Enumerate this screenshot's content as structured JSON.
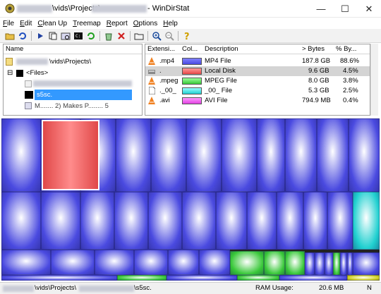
{
  "window": {
    "title_path": "\\vids\\Projects\\",
    "app_name": "- WinDirStat",
    "controls": {
      "minimize": "—",
      "maximize": "☐",
      "close": "✕"
    }
  },
  "menu": [
    {
      "label": "File",
      "key": "F",
      "rest": "ile"
    },
    {
      "label": "Edit",
      "key": "E",
      "rest": "dit"
    },
    {
      "label": "Clean Up",
      "key": "C",
      "rest": "lean Up"
    },
    {
      "label": "Treemap",
      "key": "T",
      "rest": "reemap"
    },
    {
      "label": "Report",
      "key": "R",
      "rest": "eport"
    },
    {
      "label": "Options",
      "key": "O",
      "rest": "ptions"
    },
    {
      "label": "Help",
      "key": "H",
      "rest": "elp"
    }
  ],
  "tree": {
    "header": "Name",
    "rows": [
      {
        "text": "\\vids\\Projects\\"
      },
      {
        "expander": "⊟",
        "text": "<Files>"
      },
      {
        "text": ""
      },
      {
        "text": "s5sc."
      },
      {
        "text": "M....... 2) Makes P........ 5"
      }
    ]
  },
  "ext_list": {
    "headers": {
      "ext": "Extensi...",
      "color": "Col...",
      "desc": "Description",
      "bytes": "> Bytes",
      "pct": "% By..."
    },
    "rows": [
      {
        "ext": ".mp4",
        "color": "#5b5bf0",
        "desc": "MP4 File",
        "bytes": "187.8 GB",
        "pct": "88.6%",
        "icon": "vlc-icon"
      },
      {
        "ext": ".",
        "color": "#f06a6a",
        "desc": "Local Disk",
        "bytes": "9.6 GB",
        "pct": "4.5%",
        "icon": "drive-icon"
      },
      {
        "ext": ".mpeg",
        "color": "#6af06a",
        "desc": "MPEG File",
        "bytes": "8.0 GB",
        "pct": "3.8%",
        "icon": "vlc-icon"
      },
      {
        "ext": "._00_",
        "color": "#4ef0f0",
        "desc": "_00_ File",
        "bytes": "5.3 GB",
        "pct": "2.5%",
        "icon": "file-icon"
      },
      {
        "ext": ".avi",
        "color": "#e040e0",
        "desc": "AVI File",
        "bytes": "794.9 MB",
        "pct": "0.4%",
        "icon": "vlc-icon"
      }
    ]
  },
  "status": {
    "path_a": "\\vids\\Projects\\",
    "path_b": "\\s5sc.",
    "ram_label": "RAM Usage:",
    "ram_value": "20.6 MB",
    "indicator": "N"
  },
  "colors": {
    "mp4": "#4a4ae0",
    "disk": "#e84848",
    "mpeg": "#38c838",
    "f00": "#20d0d0",
    "selection": "#3399ff"
  }
}
